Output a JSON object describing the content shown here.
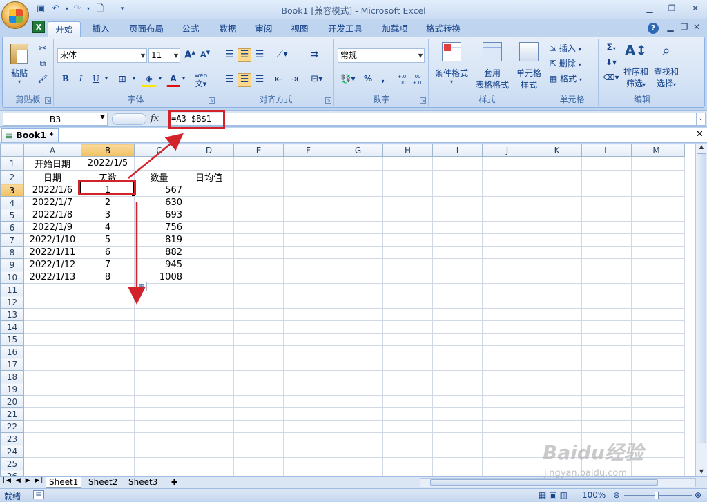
{
  "app": {
    "title": "Book1  [兼容模式] - Microsoft Excel"
  },
  "tabs": [
    "开始",
    "插入",
    "页面布局",
    "公式",
    "数据",
    "审阅",
    "视图",
    "开发工具",
    "加载项",
    "格式转换"
  ],
  "ribbon": {
    "clipboard": {
      "label": "剪贴板",
      "paste": "粘贴"
    },
    "font": {
      "label": "字体",
      "name": "宋体",
      "size": "11",
      "bold": "B",
      "italic": "I",
      "underline": "U",
      "grow": "A",
      "shrink": "A",
      "font_color": "A",
      "wen": "wén"
    },
    "align": {
      "label": "对齐方式"
    },
    "number": {
      "label": "数字",
      "format": "常规",
      "percent": "%",
      "comma": ",",
      "inc_dec": "+.0 .00",
      "dec_dec": ".00 +.0"
    },
    "styles": {
      "label": "样式",
      "conditional": "条件格式",
      "table1": "套用",
      "table2": "表格格式",
      "cell1": "单元格",
      "cell2": "样式"
    },
    "cells": {
      "label": "单元格",
      "insert": "插入",
      "delete": "删除",
      "format": "格式"
    },
    "editing": {
      "label": "编辑",
      "sum": "Σ",
      "sort1": "排序和",
      "sort2": "筛选",
      "find1": "查找和",
      "find2": "选择"
    }
  },
  "formula_bar": {
    "name_box": "B3",
    "fx": "fx",
    "formula": "=A3-$B$1"
  },
  "workbook_tab": "Book1 *",
  "columns": [
    "A",
    "B",
    "C",
    "D",
    "E",
    "F",
    "G",
    "H",
    "I",
    "J",
    "K",
    "L",
    "M"
  ],
  "rows": [
    [
      "开始日期",
      "2022/1/5",
      "",
      "",
      "",
      "",
      "",
      "",
      "",
      "",
      "",
      "",
      ""
    ],
    [
      "日期",
      "天数",
      "数量",
      "日均值",
      "",
      "",
      "",
      "",
      "",
      "",
      "",
      "",
      ""
    ],
    [
      "2022/1/6",
      "1",
      "567",
      "",
      "",
      "",
      "",
      "",
      "",
      "",
      "",
      "",
      ""
    ],
    [
      "2022/1/7",
      "2",
      "630",
      "",
      "",
      "",
      "",
      "",
      "",
      "",
      "",
      "",
      ""
    ],
    [
      "2022/1/8",
      "3",
      "693",
      "",
      "",
      "",
      "",
      "",
      "",
      "",
      "",
      "",
      ""
    ],
    [
      "2022/1/9",
      "4",
      "756",
      "",
      "",
      "",
      "",
      "",
      "",
      "",
      "",
      "",
      ""
    ],
    [
      "2022/1/10",
      "5",
      "819",
      "",
      "",
      "",
      "",
      "",
      "",
      "",
      "",
      "",
      ""
    ],
    [
      "2022/1/11",
      "6",
      "882",
      "",
      "",
      "",
      "",
      "",
      "",
      "",
      "",
      "",
      ""
    ],
    [
      "2022/1/12",
      "7",
      "945",
      "",
      "",
      "",
      "",
      "",
      "",
      "",
      "",
      "",
      ""
    ],
    [
      "2022/1/13",
      "8",
      "1008",
      "",
      "",
      "",
      "",
      "",
      "",
      "",
      "",
      "",
      ""
    ]
  ],
  "row_count": 26,
  "selected_cell": "B3",
  "sheets": [
    "Sheet1",
    "Sheet2",
    "Sheet3"
  ],
  "status": {
    "mode": "就绪",
    "zoom": "100%"
  },
  "watermark": {
    "line1": "Baidu经验",
    "line2": "jingyan.baidu.com"
  },
  "annotation_color": "#d2222a"
}
